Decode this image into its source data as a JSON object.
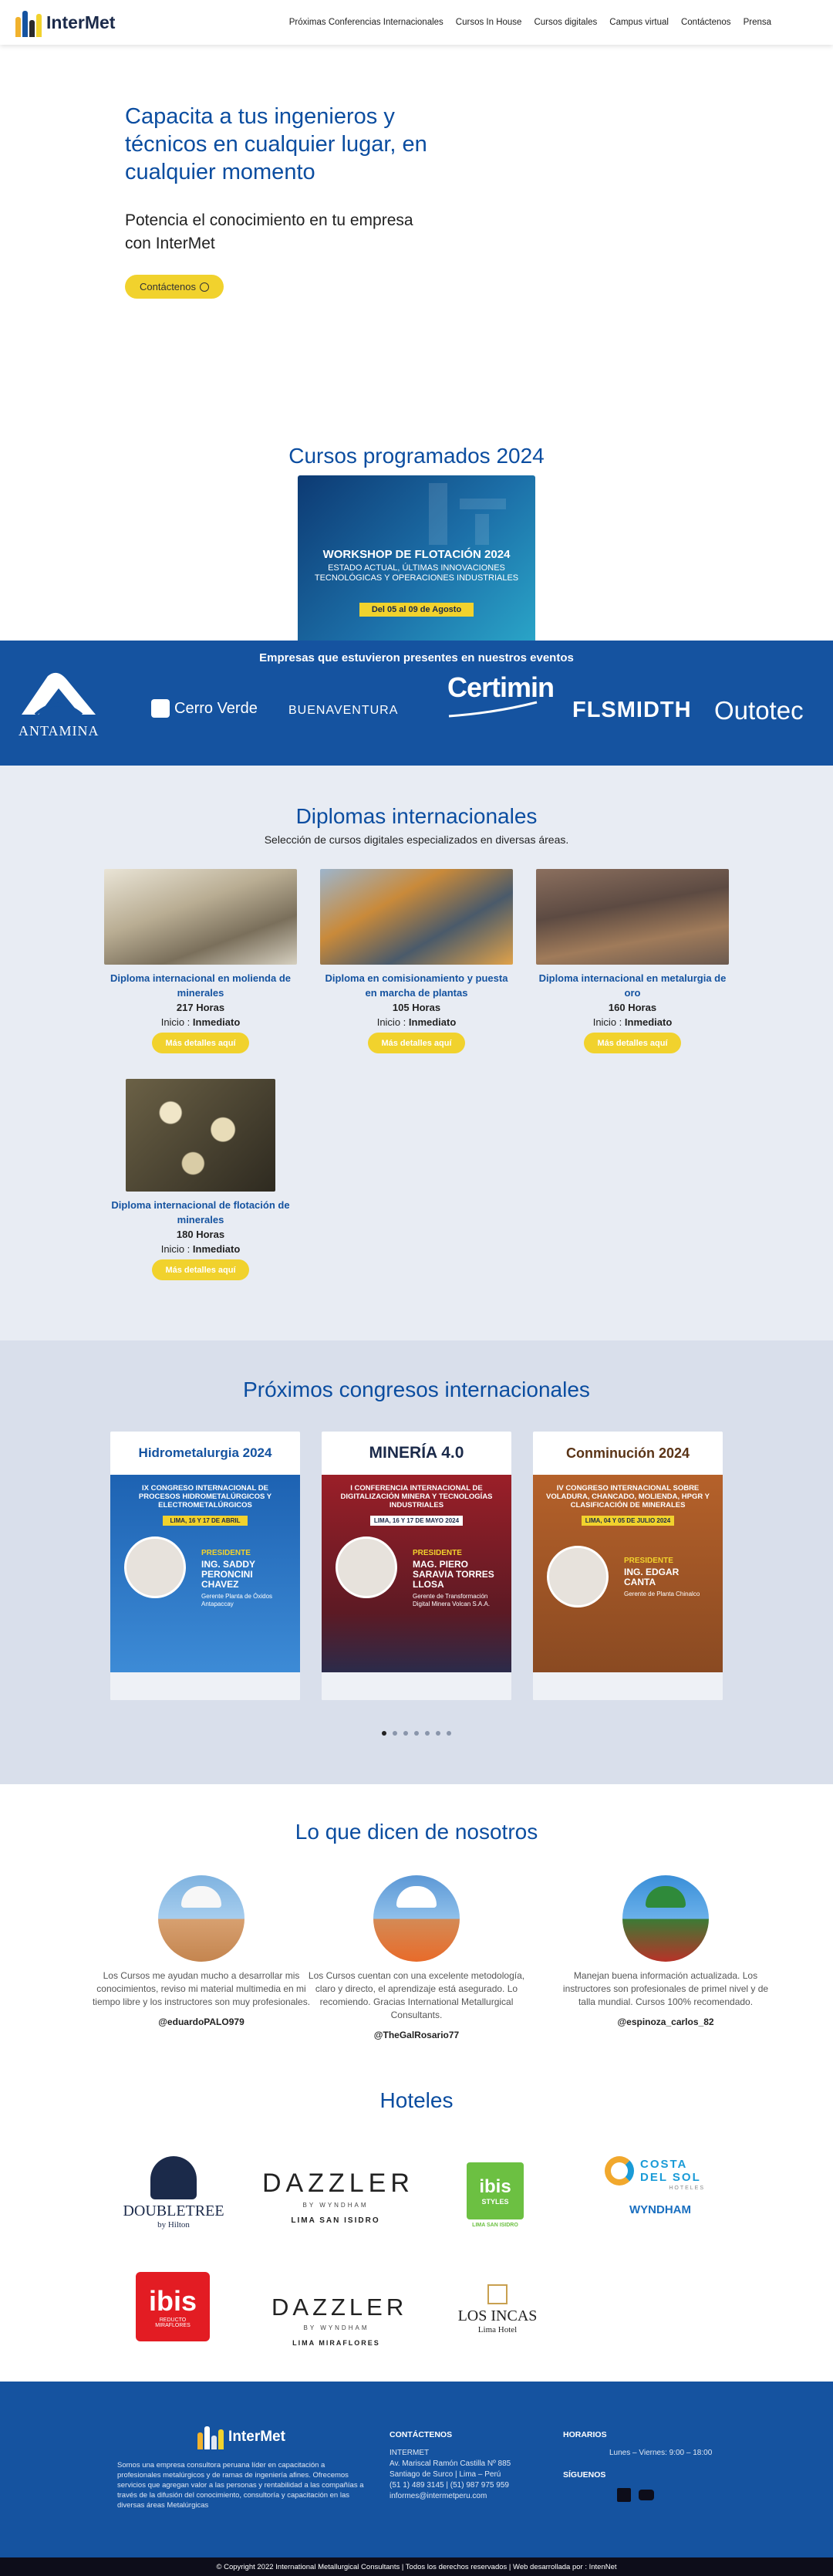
{
  "brand": {
    "name": "InterMet"
  },
  "nav": [
    "Próximas Conferencias Internacionales",
    "Cursos In House",
    "Cursos digitales",
    "Campus virtual",
    "Contáctenos",
    "Prensa"
  ],
  "hero": {
    "title": "Capacita a tus ingenieros y técnicos en cualquier lugar, en cualquier momento",
    "subtitle": "Potencia el conocimiento en tu empresa con InterMet",
    "cta": "Contáctenos",
    "cta_icon": "whatsapp-icon"
  },
  "courses": {
    "title": "Cursos programados 2024",
    "banner": {
      "title": "WORKSHOP DE FLOTACIÓN 2024",
      "subtitle": "ESTADO ACTUAL, ÚLTIMAS INNOVACIONES TECNOLÓGICAS Y OPERACIONES INDUSTRIALES",
      "date": "Del 05 al 09 de Agosto"
    }
  },
  "companies": {
    "title": "Empresas que estuvieron presentes en nuestros eventos",
    "logos": [
      "ANTAMINA",
      "Cerro Verde",
      "BUENAVENTURA",
      "Certimin",
      "FLSMIDTH",
      "Outotec"
    ]
  },
  "diplomas": {
    "title": "Diplomas internacionales",
    "subtitle": "Selección de cursos digitales especializados en diversas áreas.",
    "items": [
      {
        "name": "Diploma internacional en molienda de minerales",
        "hours": "217 Horas",
        "start_label": "Inicio : ",
        "start": "Inmediato",
        "cta": "Más detalles aquí"
      },
      {
        "name": "Diploma en comisionamiento y puesta en marcha de plantas",
        "hours": "105 Horas",
        "start_label": "Inicio : ",
        "start": "Inmediato",
        "cta": "Más detalles aquí"
      },
      {
        "name": "Diploma internacional en metalurgia de oro",
        "hours": "160 Horas",
        "start_label": "Inicio : ",
        "start": "Inmediato",
        "cta": "Más detalles aquí"
      },
      {
        "name": "Diploma internacional de flotación de minerales",
        "hours": "180 Horas",
        "start_label": "Inicio : ",
        "start": "Inmediato",
        "cta": "Más detalles aquí"
      }
    ]
  },
  "congresos": {
    "title": "Próximos congresos internacionales",
    "posters": [
      {
        "brand": "Hidrometalurgia 2024",
        "event": "IX CONGRESO INTERNACIONAL DE PROCESOS HIDROMETALÚRGICOS Y ELECTROMETALÚRGICOS",
        "date": "LIMA, 16 Y 17 DE ABRIL",
        "role": "PRESIDENTE",
        "speaker": "ING. SADDY PERONCINI CHAVEZ",
        "position": "Gerente Planta de Óxidos Antapaccay"
      },
      {
        "brand": "MINERÍA 4.0",
        "event": "I CONFERENCIA INTERNACIONAL DE DIGITALIZACIÓN MINERA Y TECNOLOGÍAS INDUSTRIALES",
        "date": "LIMA, 16 Y 17 DE MAYO 2024",
        "role": "PRESIDENTE",
        "speaker": "MAG. PIERO SARAVIA TORRES LLOSA",
        "position": "Gerente de Transformación Digital Minera Volcan S.A.A."
      },
      {
        "brand": "Conminución 2024",
        "event": "IV CONGRESO INTERNACIONAL SOBRE VOLADURA, CHANCADO, MOLIENDA, HPGR Y CLASIFICACIÓN DE MINERALES",
        "date": "LIMA, 04 Y 05 DE JULIO 2024",
        "role": "PRESIDENTE",
        "speaker": "ING. EDGAR CANTA",
        "position": "Gerente de Planta Chinalco"
      }
    ],
    "dots": 7,
    "active_dot": 0
  },
  "testimonials": {
    "title": "Lo que dicen de nosotros",
    "items": [
      {
        "text": "Los Cursos me ayudan mucho a desarrollar mis conocimientos, reviso mi material multimedia en mi tiempo libre y los instructores son muy profesionales.",
        "user": "@eduardoPALO979"
      },
      {
        "text": "Los Cursos cuentan con una excelente metodología, claro y directo, el aprendizaje está asegurado. Lo recomiendo. Gracias International Metallurgical Consultants.",
        "user": "@TheGalRosario77"
      },
      {
        "text": "Manejan buena información actualizada. Los instructores son profesionales de primel nivel y de talla mundial. Cursos 100% recomendado.",
        "user": "@espinoza_carlos_82"
      }
    ]
  },
  "hotels": {
    "title": "Hoteles",
    "items": [
      {
        "name": "DOUBLETREE",
        "sub": "by Hilton"
      },
      {
        "name": "DAZZLER",
        "brand": "BY WYNDHAM",
        "city": "LIMA SAN ISIDRO"
      },
      {
        "name": "ibis",
        "sub": "STYLES",
        "city": "LIMA SAN ISIDRO"
      },
      {
        "name": "COSTA DEL SOL",
        "sub": "HOTELES",
        "brand": "WYNDHAM"
      },
      {
        "name": "ibis",
        "sub": "REDUCTO MIRAFLORES"
      },
      {
        "name": "DAZZLER",
        "brand": "BY WYNDHAM",
        "city": "LIMA MIRAFLORES"
      },
      {
        "name": "LOS INCAS",
        "sub": "Lima Hotel"
      }
    ]
  },
  "footer": {
    "about": "Somos una empresa consultora peruana líder en capacitación a profesionales metalúrgicos y de ramas de ingeniería afines. Ofrecemos servicios que agregan valor a las personas y rentabilidad a las compañías a través de la difusión del conocimiento, consultoría y capacitación en las diversas áreas Metalúrgicas",
    "contact_title": "CONTÁCTENOS",
    "contact_lines": [
      "INTERMET",
      "Av. Mariscal Ramón Castilla Nº 885",
      "Santiago de Surco  |  Lima – Perú",
      "(51 1) 489 3145  |  (51) 987 975 959",
      "informes@intermetperu.com"
    ],
    "hours_title": "HORARIOS",
    "hours": "Lunes – Viernes: 9:00 – 18:00",
    "follow_title": "SÍGUENOS",
    "copyright": "© Copyright 2022 International Metallurgical Consultants | Todos los derechos reservados | Web desarrollada por : IntenNet"
  },
  "colors": {
    "primary": "#0b4da0",
    "band": "#1553a0",
    "accent": "#f1d22d"
  }
}
